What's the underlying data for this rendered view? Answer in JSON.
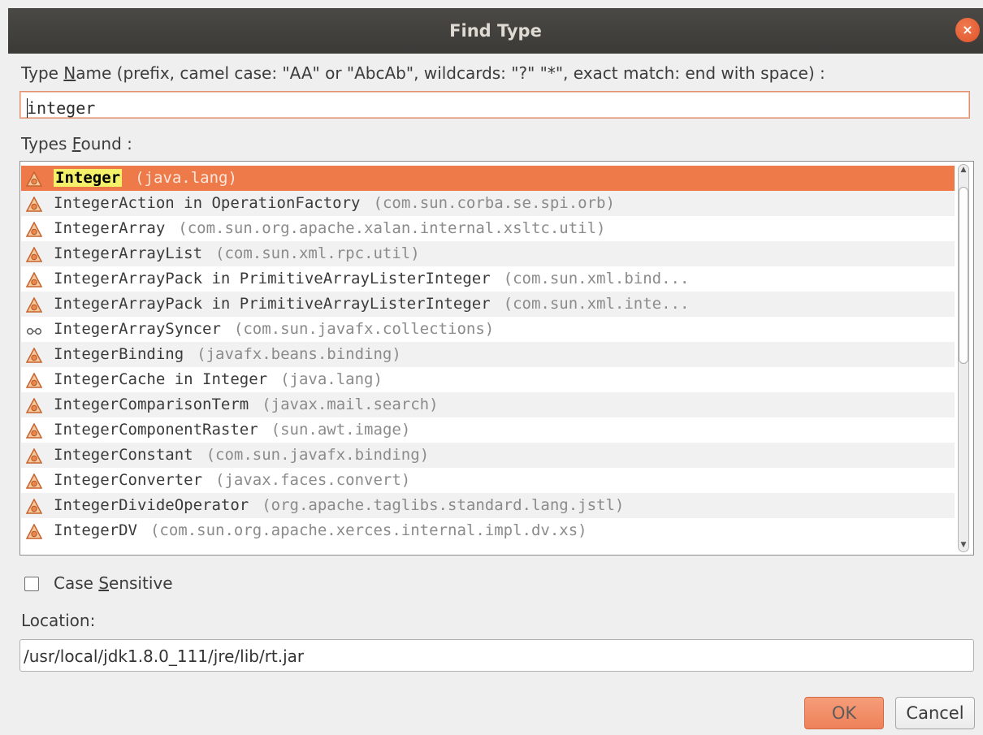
{
  "window": {
    "title": "Find Type",
    "close_glyph": "×"
  },
  "name_label": {
    "pre": "Type ",
    "mnemonic": "N",
    "post": "ame (prefix, camel case: \"AA\" or \"AbcAb\", wildcards: \"?\" \"*\", exact match: end with space) :"
  },
  "name_input": {
    "value": "integer"
  },
  "types_label": {
    "pre": "Types ",
    "mnemonic": "F",
    "post": "ound :"
  },
  "types": [
    {
      "name": "Integer",
      "package": "(java.lang)",
      "icon": "class-icon",
      "selected": true
    },
    {
      "name": "IntegerAction in OperationFactory",
      "package": "(com.sun.corba.se.spi.orb)",
      "icon": "class-icon"
    },
    {
      "name": "IntegerArray",
      "package": "(com.sun.org.apache.xalan.internal.xsltc.util)",
      "icon": "class-icon"
    },
    {
      "name": "IntegerArrayList",
      "package": "(com.sun.xml.rpc.util)",
      "icon": "class-icon"
    },
    {
      "name": "IntegerArrayPack in PrimitiveArrayListerInteger",
      "package": "(com.sun.xml.bind...",
      "icon": "class-icon"
    },
    {
      "name": "IntegerArrayPack in PrimitiveArrayListerInteger",
      "package": "(com.sun.xml.inte...",
      "icon": "class-icon"
    },
    {
      "name": "IntegerArraySyncer",
      "package": "(com.sun.javafx.collections)",
      "icon": "interface-icon"
    },
    {
      "name": "IntegerBinding",
      "package": "(javafx.beans.binding)",
      "icon": "class-icon"
    },
    {
      "name": "IntegerCache in Integer",
      "package": "(java.lang)",
      "icon": "class-icon"
    },
    {
      "name": "IntegerComparisonTerm",
      "package": "(javax.mail.search)",
      "icon": "class-icon"
    },
    {
      "name": "IntegerComponentRaster",
      "package": "(sun.awt.image)",
      "icon": "class-icon"
    },
    {
      "name": "IntegerConstant",
      "package": "(com.sun.javafx.binding)",
      "icon": "class-icon"
    },
    {
      "name": "IntegerConverter",
      "package": "(javax.faces.convert)",
      "icon": "class-icon"
    },
    {
      "name": "IntegerDivideOperator",
      "package": "(org.apache.taglibs.standard.lang.jstl)",
      "icon": "class-icon"
    },
    {
      "name": "IntegerDV",
      "package": "(com.sun.org.apache.xerces.internal.impl.dv.xs)",
      "icon": "class-icon"
    }
  ],
  "case_sensitive": {
    "pre": "Case ",
    "mnemonic": "S",
    "post": "ensitive",
    "checked": false
  },
  "location": {
    "label": "Location:",
    "value": "/usr/local/jdk1.8.0_111/jre/lib/rt.jar"
  },
  "buttons": {
    "ok": "OK",
    "cancel": "Cancel"
  },
  "colors": {
    "selection": "#ee7a4a",
    "accent": "#e0532b",
    "titlebar": "#3b3a37"
  }
}
